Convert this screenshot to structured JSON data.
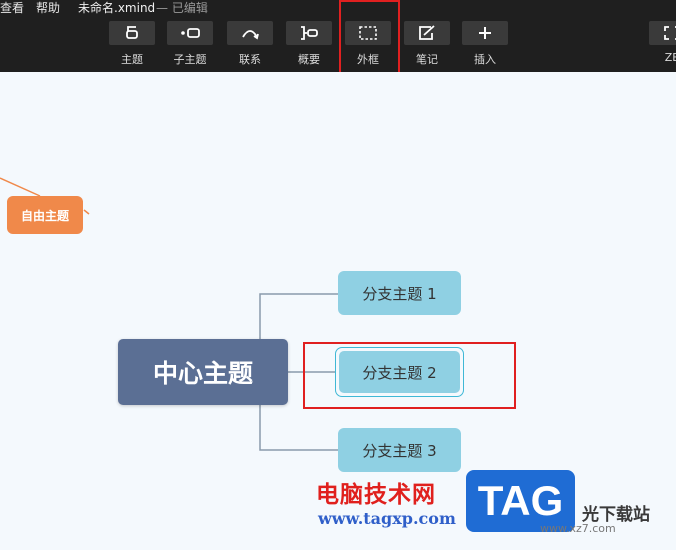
{
  "menubar": {
    "items": [
      "查看",
      "帮助"
    ],
    "file_name": "未命名.xmind",
    "status": "— 已编辑"
  },
  "toolbar": {
    "buttons": [
      {
        "label": "主题",
        "icon": "topic-icon"
      },
      {
        "label": "子主题",
        "icon": "subtopic-icon"
      },
      {
        "label": "联系",
        "icon": "relationship-icon"
      },
      {
        "label": "概要",
        "icon": "summary-icon"
      },
      {
        "label": "外框",
        "icon": "boundary-icon"
      },
      {
        "label": "笔记",
        "icon": "note-icon"
      },
      {
        "label": "插入",
        "icon": "plus-icon"
      },
      {
        "label": "ZE",
        "icon": "zen-mode-icon"
      }
    ]
  },
  "mindmap": {
    "floating_topic": "自由主题",
    "central_topic": "中心主题",
    "branches": [
      "分支主题 1",
      "分支主题 2",
      "分支主题 3"
    ]
  },
  "watermark": {
    "text": "电脑技术网",
    "url": "www.tagxp.com",
    "tag": "TAG",
    "site": "光下载站",
    "site_url": "www.xz7.com"
  },
  "colors": {
    "toolbar_bg": "#1f1f1f",
    "canvas_bg": "#f4f9fd",
    "central_topic_bg": "#5b6f94",
    "branch_bg": "#8fd0e3",
    "floating_topic_bg": "#f0894a",
    "highlight": "#e02020"
  }
}
